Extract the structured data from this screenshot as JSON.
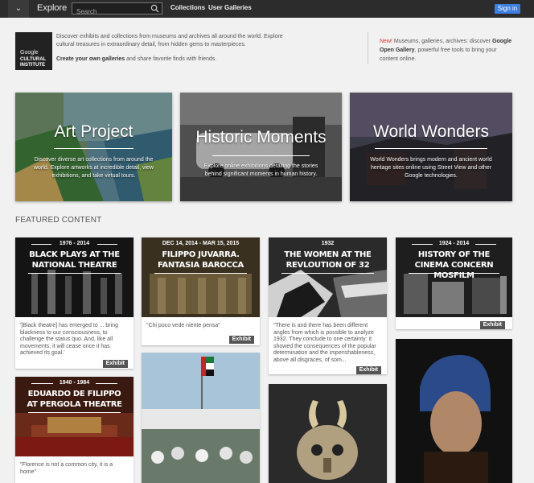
{
  "topbar": {
    "menu_glyph": "⌄",
    "explore": "Explore",
    "search_placeholder": "Search",
    "nav": [
      "Collections",
      "User Galleries"
    ],
    "signin": "Sign in"
  },
  "logo": {
    "line1": "Google",
    "line2": "CULTURAL",
    "line3": "INSTITUTE"
  },
  "intro": {
    "text": "Discover exhibits and collections from museums and archives all around the world. Explore cultural treasures in extraordinary detail, from hidden gems to masterpieces.",
    "cta_bold": "Create your own galleries",
    "cta_rest": " and share favorite finds with friends."
  },
  "news": {
    "new_label": "New!",
    "text": " Museums, galleries, archives: discover ",
    "bold": "Google Open Gallery",
    "rest": ", powerful free tools to bring your content online."
  },
  "heroes": [
    {
      "title": "Art Project",
      "desc": "Discover diverse art collections from around the world. Explore artworks at incredible detail, view exhibitions, and take virtual tours."
    },
    {
      "title": "Historic Moments",
      "desc": "Explore online exhibitions detailing the stories behind significant moments in human history."
    },
    {
      "title": "World Wonders",
      "desc": "World Wonders brings modern and ancient world heritage sites online using Street View and other Google technologies."
    }
  ],
  "featured_title": "FEATURED CONTENT",
  "cards": [
    {
      "date": "1976 - 2014",
      "title": "BLACK PLAYS AT THE NATIONAL THEATRE",
      "quote": "'[Black theatre] has emerged to ... bring blackness to our consciousness, to challenge the status quo. And, like all movements, it will cease once it has achieved its goal.'",
      "badge": "Exhibit"
    },
    {
      "date": "DEC 14, 2014 - MAR 15, 2015",
      "title": "FILIPPO JUVARRA. FANTASIA BAROCCA",
      "quote": "\"Chi poco vede niente pensa\"",
      "badge": "Exhibit"
    },
    {
      "date": "1932",
      "title": "THE WOMEN AT THE REVLOUTION OF 32",
      "quote": "\"There is and there has been different angles from which is possible to analyze 1932. They conclude to one certainty: it showed the consequences of the popular determination and the imperishableness, above all disgraces, of som...",
      "badge": "Exhibit"
    },
    {
      "date": "1924 - 2014",
      "title": "HISTORY OF THE CINEMA CONCERN MOSFILM",
      "quote": "",
      "badge": "Exhibit"
    },
    {
      "date": "1940 - 1984",
      "title": "EDUARDO DE FILIPPO AT PERGOLA THEATRE",
      "quote": "\"Florence is not a common city, it is a home\"",
      "badge": ""
    }
  ],
  "colors": {
    "topbar": "#2c2c2c",
    "signin": "#3c7ee4",
    "new": "#dd3333",
    "badge": "#555555"
  }
}
